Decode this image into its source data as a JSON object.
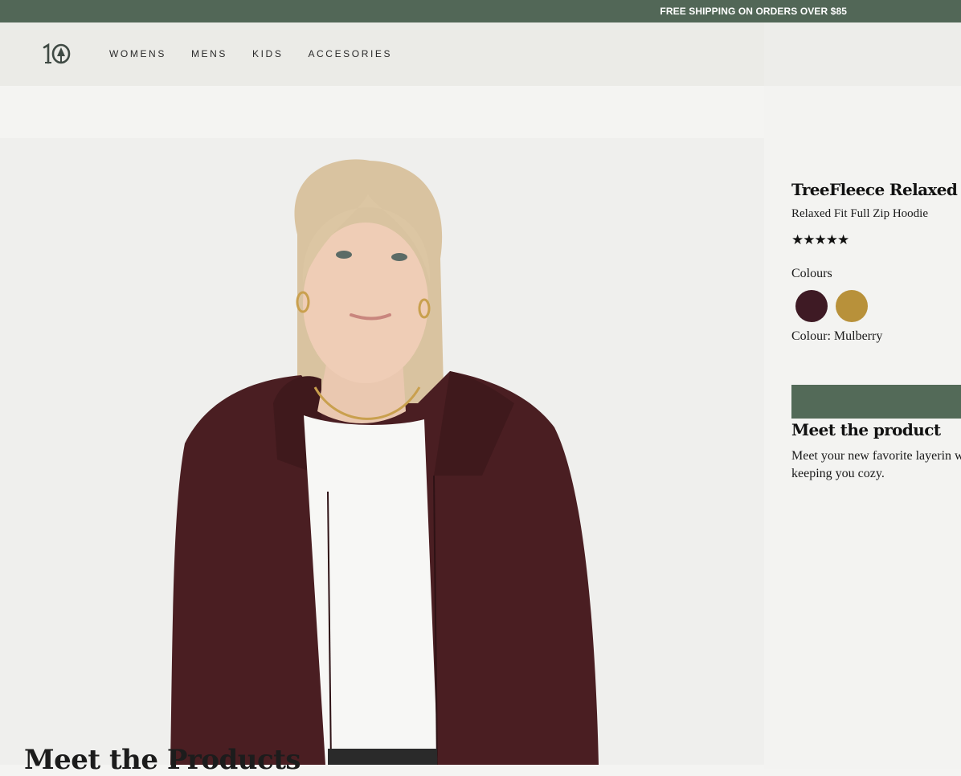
{
  "announcement": {
    "text": "FREE SHIPPING ON ORDERS OVER $85"
  },
  "header": {
    "logo_text": "10",
    "nav": [
      "WOMENS",
      "MENS",
      "KIDS",
      "ACCESORIES"
    ]
  },
  "gallery": {
    "image_icon": "model-photo",
    "heading": "Meet the Products"
  },
  "product": {
    "title": "TreeFleece Relaxed Zip",
    "subtitle": "Relaxed Fit Full Zip Hoodie",
    "rating_stars": "★★★★★",
    "rating": 5,
    "colours_label": "Colours",
    "swatches": [
      {
        "name": "Mulberry",
        "color": "#3e1a24"
      },
      {
        "name": "Mustard",
        "color": "#b8913a"
      }
    ],
    "selected_colour_text": "Colour: Mulberry",
    "meet_title": "Meet the product",
    "meet_body": "Meet your new favorite layerin while keeping you cozy."
  },
  "colors": {
    "accent_green": "#526757",
    "mulberry": "#3e1a24",
    "mustard": "#b8913a"
  }
}
